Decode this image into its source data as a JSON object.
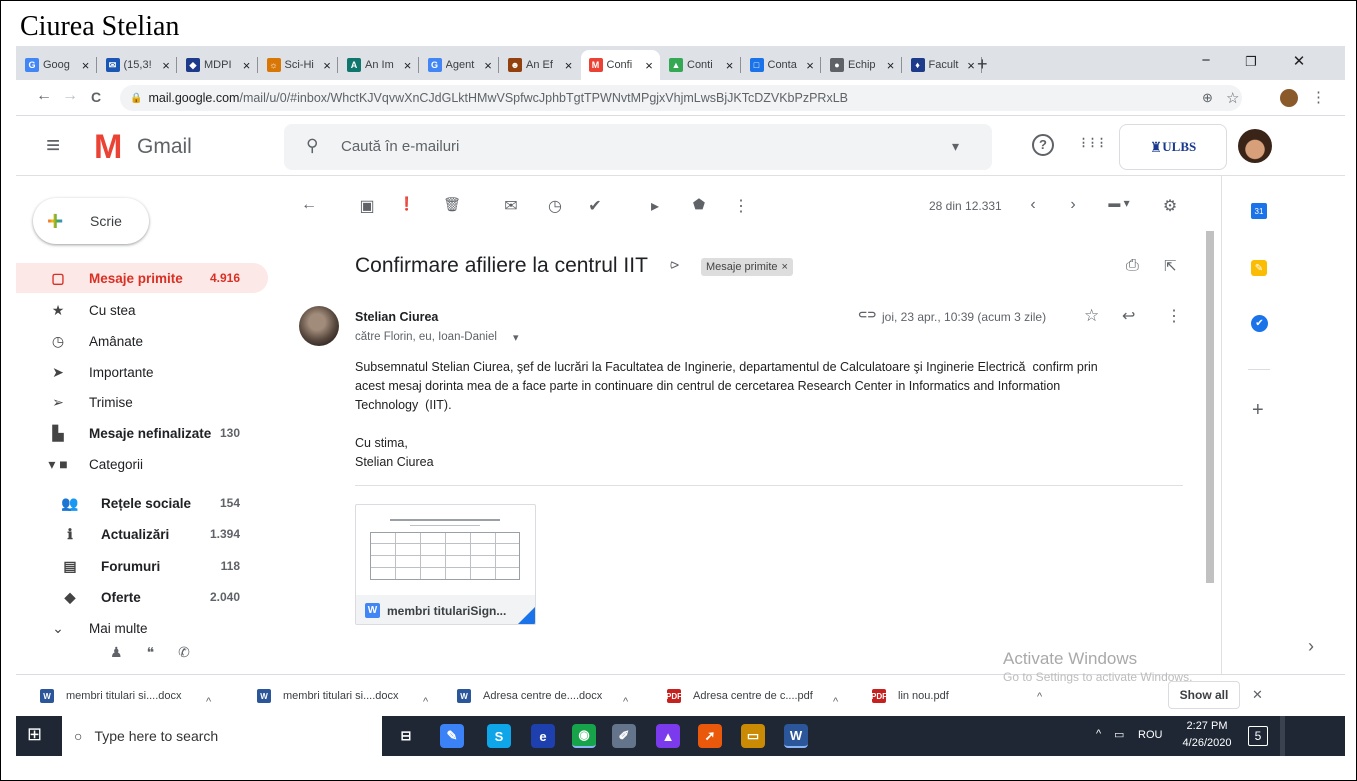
{
  "heading": "Ciurea Stelian",
  "browser": {
    "tabs": [
      {
        "label": "Goog",
        "fav": "G",
        "color": "#4285f4"
      },
      {
        "label": "(15,3!",
        "fav": "✉",
        "color": "#1a56b3"
      },
      {
        "label": "MDPI",
        "fav": "◆",
        "color": "#1e3a8a"
      },
      {
        "label": "Sci-Hi",
        "fav": "☼",
        "color": "#d97706"
      },
      {
        "label": "An Im",
        "fav": "A",
        "color": "#0f766e"
      },
      {
        "label": "Agent",
        "fav": "G",
        "color": "#4285f4"
      },
      {
        "label": "An Ef",
        "fav": "☻",
        "color": "#92400e"
      },
      {
        "label": "Confi",
        "fav": "M",
        "color": "#ea4335"
      },
      {
        "label": "Conti",
        "fav": "▲",
        "color": "#34a853"
      },
      {
        "label": "Conta",
        "fav": "□",
        "color": "#1a73e8"
      },
      {
        "label": "Echip",
        "fav": "●",
        "color": "#5f6368"
      },
      {
        "label": "Facult",
        "fav": "♦",
        "color": "#1e3a8a"
      }
    ],
    "close_glyph": "×",
    "new_tab": "+",
    "win_min": "−",
    "win_restore": "❐",
    "win_close": "✕",
    "url_domain": "mail.google.com",
    "url_path": "/mail/u/0/#inbox/WhctKJVqvwXnCJdGLktHMwVSpfwcJphbTgtTPWNvtMPgjxVhjmLwsBjJKTcDZVKbPzPRxLB",
    "nav_back": "←",
    "nav_forward": "→",
    "nav_reload": "C",
    "zoom_icon": "⊕",
    "star_icon": "☆",
    "menu_icon": "⋮"
  },
  "gmail": {
    "menu_icon": "≡",
    "logo_m": "M",
    "logo_text": "Gmail",
    "search_placeholder": "Caută în e-mailuri",
    "search_icon": "⚲",
    "search_dropdown": "▾",
    "help_icon": "?",
    "apps_icon": "⋮⋮⋮",
    "org_logo_text": "ULBS",
    "compose_label": "Scrie",
    "sidebar": [
      {
        "icon": "▢",
        "label": "Mesaje primite",
        "count": "4.916",
        "selected": true
      },
      {
        "icon": "★",
        "label": "Cu stea",
        "count": ""
      },
      {
        "icon": "◷",
        "label": "Amânate",
        "count": ""
      },
      {
        "icon": "➤",
        "label": "Importante",
        "count": ""
      },
      {
        "icon": "➢",
        "label": "Trimise",
        "count": ""
      },
      {
        "icon": "▙",
        "label": "Mesaje nefinalizate",
        "count": "130",
        "bold": true
      },
      {
        "icon": "▾ ■",
        "label": "Categorii",
        "count": ""
      },
      {
        "icon": "👥",
        "label": "Rețele sociale",
        "count": "154",
        "bold": true,
        "sub": true
      },
      {
        "icon": "ℹ",
        "label": "Actualizări",
        "count": "1.394",
        "bold": true,
        "sub": true
      },
      {
        "icon": "▤",
        "label": "Forumuri",
        "count": "118",
        "bold": true,
        "sub": true
      },
      {
        "icon": "◆",
        "label": "Oferte",
        "count": "2.040",
        "bold": true,
        "sub": true
      },
      {
        "icon": "⌄",
        "label": "Mai multe",
        "count": ""
      }
    ],
    "sidebar_bottom_icons": [
      "♟",
      "❝",
      "✆"
    ],
    "toolbar": {
      "back": "←",
      "archive": "▣",
      "spam": "❗",
      "delete": "🗑",
      "mark": "✉",
      "snooze": "◷",
      "task": "✔",
      "move": "▸",
      "label": "⬟",
      "more": "⋮",
      "pagination": "28 din 12.331",
      "prev": "‹",
      "next": "›",
      "input_tools": "▬ ▾",
      "settings": "⚙"
    },
    "message": {
      "subject": "Confirmare afiliere la centrul IIT",
      "importance_marker": "⪧",
      "label_chip": "Mesaje primite",
      "label_chip_close": "×",
      "print_icon": "⎙",
      "open_icon": "⇱",
      "sender": "Stelian Ciurea",
      "recipients": "către Florin, eu, Ioan-Daniel",
      "recipients_dropdown": "▾",
      "attach_icon": "⊂⊃",
      "date": "joi, 23 apr., 10:39 (acum 3 zile)",
      "star": "☆",
      "reply": "↩",
      "more": "⋮",
      "body": [
        "Subsemnatul Stelian Ciurea, şef de lucrări la Facultatea de Inginerie, departamentul de Calculatoare şi Inginerie Electrică  confirm prin",
        "acest mesaj dorinta mea de a face parte in continuare din centrul de cercetarea Research Center in Informatics and Information",
        "Technology  (IIT).",
        "",
        "Cu stima,",
        "Stelian Ciurea"
      ],
      "attachment_name": "membri titulariSign...",
      "attachment_type": "W"
    },
    "right_panel": {
      "calendar": "31",
      "keep": "✎",
      "tasks": "✔",
      "add": "+",
      "expand": "›"
    }
  },
  "watermark": {
    "title": "Activate Windows",
    "subtitle": "Go to Settings to activate Windows."
  },
  "downloads": {
    "items": [
      {
        "name": "membri titulari si....docx",
        "type": "W",
        "color": "#2b579a"
      },
      {
        "name": "membri titulari si....docx",
        "type": "W",
        "color": "#2b579a"
      },
      {
        "name": "Adresa centre de....docx",
        "type": "W",
        "color": "#2b579a"
      },
      {
        "name": "Adresa centre de c....pdf",
        "type": "PDF",
        "color": "#c5221f"
      },
      {
        "name": "lin nou.pdf",
        "type": "PDF",
        "color": "#c5221f"
      }
    ],
    "chevron": "^",
    "show_all": "Show all",
    "close": "✕"
  },
  "taskbar": {
    "start_icon": "⊞",
    "search_placeholder": "Type here to search",
    "search_icon": "○",
    "apps": [
      {
        "name": "task-view",
        "glyph": "⊟",
        "color": "#1f2735"
      },
      {
        "name": "paint",
        "glyph": "✎",
        "color": "#3b82f6"
      },
      {
        "name": "skype",
        "glyph": "S",
        "color": "#0ea5e9"
      },
      {
        "name": "edge",
        "glyph": "e",
        "color": "#1e40af"
      },
      {
        "name": "chrome",
        "glyph": "◉",
        "color": "#16a34a"
      },
      {
        "name": "paintbrush",
        "glyph": "✐",
        "color": "#64748b"
      },
      {
        "name": "app-7",
        "glyph": "▲",
        "color": "#7c3aed"
      },
      {
        "name": "matlab",
        "glyph": "➚",
        "color": "#ea580c"
      },
      {
        "name": "explorer",
        "glyph": "▭",
        "color": "#ca8a04"
      },
      {
        "name": "word",
        "glyph": "W",
        "color": "#2b579a"
      }
    ],
    "tray_up": "^",
    "tray_net": "▭",
    "lang": "ROU",
    "time": "2:27 PM",
    "date": "4/26/2020",
    "notif": "5"
  }
}
